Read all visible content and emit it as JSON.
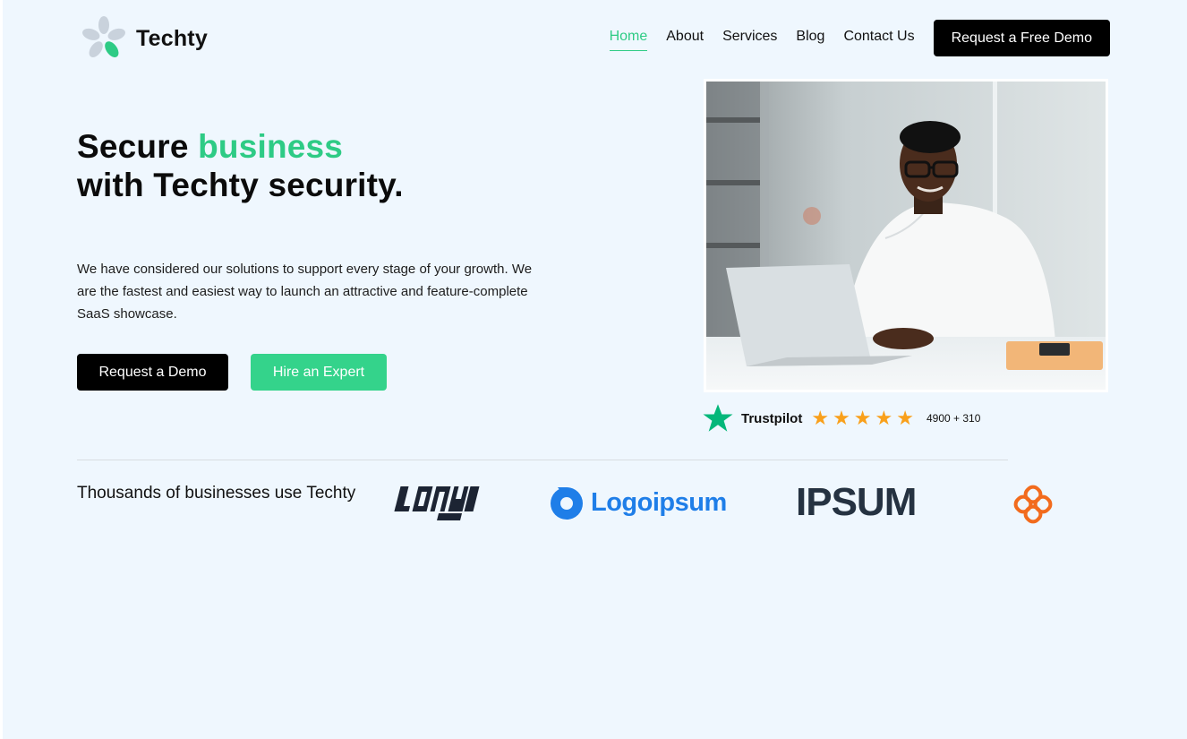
{
  "brand": {
    "name": "Techty"
  },
  "nav": {
    "items": [
      {
        "label": "Home",
        "active": true
      },
      {
        "label": "About",
        "active": false
      },
      {
        "label": "Services",
        "active": false
      },
      {
        "label": "Blog",
        "active": false
      },
      {
        "label": "Contact Us",
        "active": false
      }
    ],
    "cta_label": "Request a Free Demo"
  },
  "hero": {
    "headline_part1": "Secure ",
    "headline_accent": "business",
    "headline_line2": "with Techty security.",
    "description": "We have considered our solutions to support every stage of your growth. We are the fastest and easiest way to launch an attractive and feature-complete SaaS showcase.",
    "primary_button": "Request a Demo",
    "secondary_button": "Hire an Expert"
  },
  "trust": {
    "brand": "Trustpilot",
    "stars": 5,
    "count": "4900 + 310"
  },
  "logos": {
    "intro_text": "Thousands of businesses use Techty",
    "logo2_text": "Logoipsum",
    "logo3_text": "IPSUM"
  },
  "colors": {
    "accent": "#2ecb85",
    "button_green": "#34d38b",
    "star": "#f9a01b",
    "background": "#eff7fe"
  }
}
